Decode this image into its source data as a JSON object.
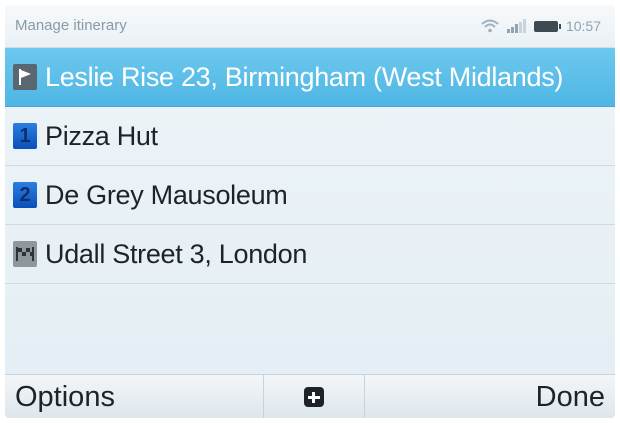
{
  "status_bar": {
    "title": "Manage itinerary",
    "time": "10:57"
  },
  "itinerary": [
    {
      "icon": "departure-flag-icon",
      "label": "Leslie Rise 23, Birmingham (West Midlands)",
      "selected": true
    },
    {
      "icon": "number-badge",
      "number": "1",
      "label": "Pizza Hut"
    },
    {
      "icon": "number-badge",
      "number": "2",
      "label": "De Grey Mausoleum"
    },
    {
      "icon": "destination-checkered-flag-icon",
      "label": "Udall Street 3, London"
    }
  ],
  "softkeys": {
    "left": "Options",
    "middle_icon": "add-icon",
    "right": "Done"
  },
  "colors": {
    "selected_row": "#55bbe6",
    "number_badge": "#1a64cc"
  }
}
